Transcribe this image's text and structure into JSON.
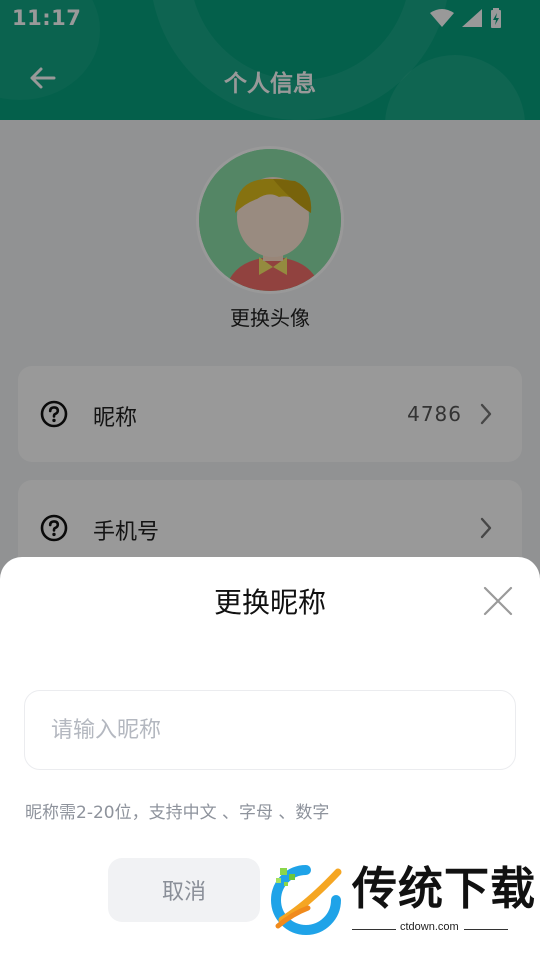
{
  "status_bar": {
    "time": "11:17"
  },
  "header": {
    "title": "个人信息"
  },
  "avatar": {
    "change_label": "更换头像"
  },
  "rows": [
    {
      "label": "昵称",
      "value": "4786"
    },
    {
      "label": "手机号",
      "value": ""
    }
  ],
  "sheet": {
    "title": "更换昵称",
    "input_placeholder": "请输入昵称",
    "input_value": "",
    "hint": "昵称需2-20位，支持中文 、字母 、数字",
    "cancel_label": "取消"
  },
  "watermark": {
    "brand": "传统下载",
    "url": "ctdown.com"
  },
  "colors": {
    "header": "#07a17e",
    "overlay": "rgba(0,0,0,0.40)",
    "avatar_bg": "#8de0a8"
  }
}
